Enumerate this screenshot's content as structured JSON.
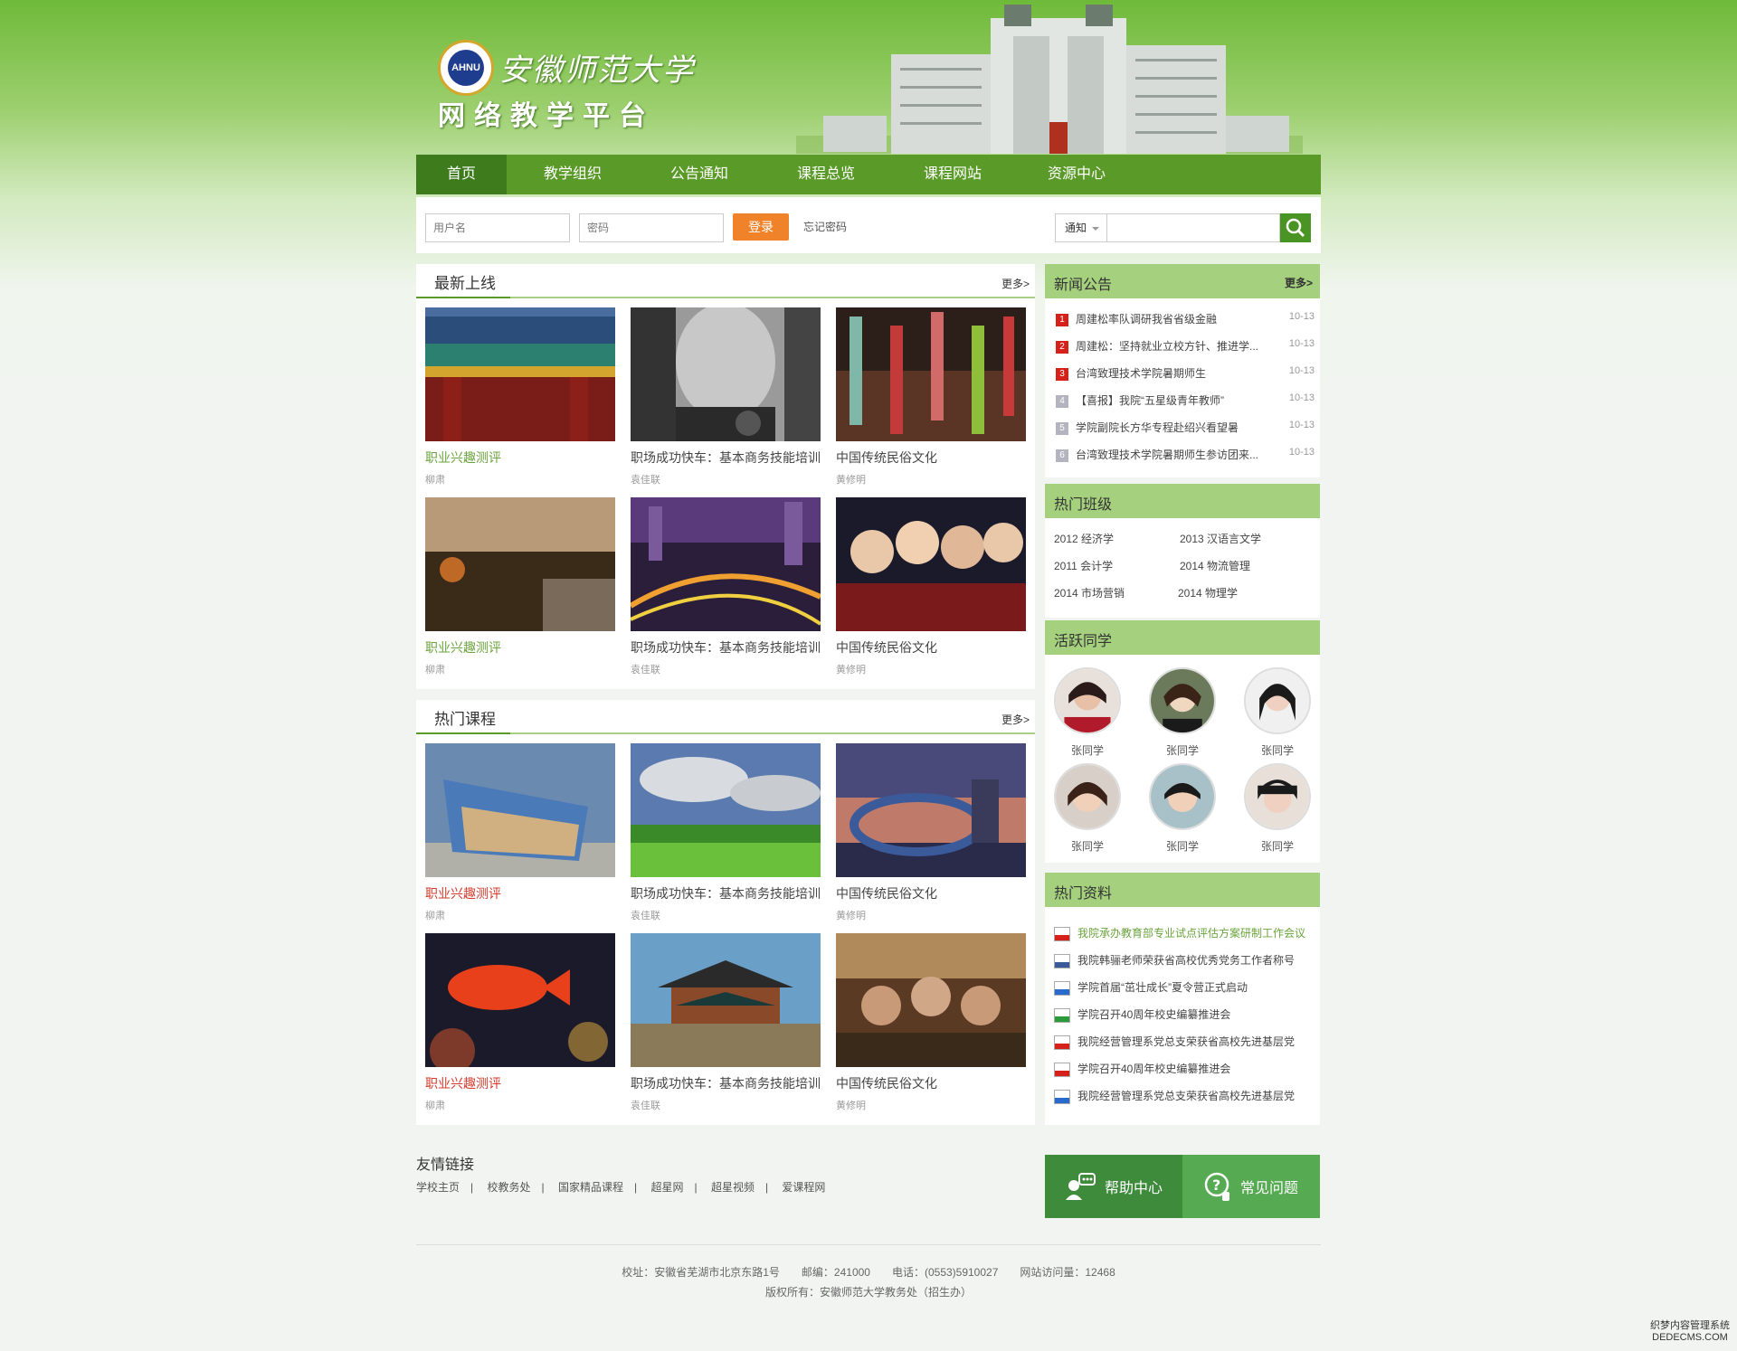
{
  "header": {
    "school_name": "安徽师范大学",
    "platform_name": "网络教学平台",
    "emblem_text": "AHNU"
  },
  "nav": [
    {
      "label": "首页",
      "active": true
    },
    {
      "label": "教学组织"
    },
    {
      "label": "公告通知"
    },
    {
      "label": "课程总览"
    },
    {
      "label": "课程网站"
    },
    {
      "label": "资源中心"
    }
  ],
  "login": {
    "username_placeholder": "用户名",
    "password_placeholder": "密码",
    "login_button": "登录",
    "forgot_password": "忘记密码"
  },
  "search": {
    "category": "通知"
  },
  "latest": {
    "title": "最新上线",
    "more": "更多>",
    "items": [
      {
        "title": "职业兴趣测评",
        "author": "柳肃",
        "style": "green"
      },
      {
        "title": "职场成功快车：基本商务技能培训",
        "author": "袁佳联"
      },
      {
        "title": "中国传统民俗文化",
        "author": "黄修明"
      },
      {
        "title": "职业兴趣测评",
        "author": "柳肃",
        "style": "green"
      },
      {
        "title": "职场成功快车：基本商务技能培训",
        "author": "袁佳联"
      },
      {
        "title": "中国传统民俗文化",
        "author": "黄修明"
      }
    ]
  },
  "hot_courses": {
    "title": "热门课程",
    "more": "更多>",
    "items": [
      {
        "title": "职业兴趣测评",
        "author": "柳肃",
        "style": "red"
      },
      {
        "title": "职场成功快车：基本商务技能培训",
        "author": "袁佳联"
      },
      {
        "title": "中国传统民俗文化",
        "author": "黄修明"
      },
      {
        "title": "职业兴趣测评",
        "author": "柳肃",
        "style": "red"
      },
      {
        "title": "职场成功快车：基本商务技能培训",
        "author": "袁佳联"
      },
      {
        "title": "中国传统民俗文化",
        "author": "黄修明"
      }
    ]
  },
  "news": {
    "title": "新闻公告",
    "more": "更多>",
    "items": [
      {
        "num": "1",
        "text": "周建松率队调研我省省级金融",
        "date": "10-13"
      },
      {
        "num": "2",
        "text": "周建松：坚持就业立校方针、推进学...",
        "date": "10-13"
      },
      {
        "num": "3",
        "text": "台湾致理技术学院暑期师生",
        "date": "10-13"
      },
      {
        "num": "4",
        "text": "【喜报】我院“五星级青年教师”",
        "date": "10-13"
      },
      {
        "num": "5",
        "text": "学院副院长方华专程赴绍兴看望暑",
        "date": "10-13"
      },
      {
        "num": "6",
        "text": "台湾致理技术学院暑期师生参访团来...",
        "date": "10-13"
      }
    ]
  },
  "hot_classes": {
    "title": "热门班级",
    "items": [
      "2012 经济学",
      "2013 汉语言文学",
      "2011 会计学",
      "2014 物流管理",
      "2014 市场营销",
      "2014 物理学"
    ]
  },
  "active_students": {
    "title": "活跃同学",
    "items": [
      "张同学",
      "张同学",
      "张同学",
      "张同学",
      "张同学",
      "张同学"
    ]
  },
  "hot_resources": {
    "title": "热门资料",
    "items": [
      {
        "type": "pdf",
        "text": "我院承办教育部专业试点评估方案研制工作会议",
        "highlight": true
      },
      {
        "type": "txt",
        "text": "我院韩骊老师荣获省高校优秀党务工作者称号"
      },
      {
        "type": "word",
        "text": "学院首届“茁壮成长”夏令营正式启动"
      },
      {
        "type": "excel",
        "text": "学院召开40周年校史编纂推进会"
      },
      {
        "type": "pdf",
        "text": "我院经营管理系党总支荣获省高校先进基层党"
      },
      {
        "type": "pdf",
        "text": "学院召开40周年校史编纂推进会"
      },
      {
        "type": "word",
        "text": "我院经营管理系党总支荣获省高校先进基层党"
      }
    ]
  },
  "friend_links": {
    "title": "友情链接",
    "items": [
      "学校主页",
      "校教务处",
      "国家精品课程",
      "超星网",
      "超星视频",
      "爱课程网"
    ],
    "separator": "|"
  },
  "help": {
    "help_center": "帮助中心",
    "faq": "常见问题"
  },
  "footer": {
    "line1": "校址：安徽省芜湖市北京东路1号　　邮编：241000　　电话：(0553)5910027　　网站访问量：12468",
    "line2": "版权所有：安徽师范大学教务处（招生办）"
  },
  "watermark": {
    "line1": "织梦内容管理系统",
    "line2": "DEDECMS.COM"
  },
  "colors": {
    "brand_green": "#5a9a28",
    "nav_active": "#3d7b1c",
    "login_orange": "#f0832a",
    "side_header": "#a5d07d",
    "help_dark": "#3d8b3b",
    "help_light": "#56aa52"
  }
}
